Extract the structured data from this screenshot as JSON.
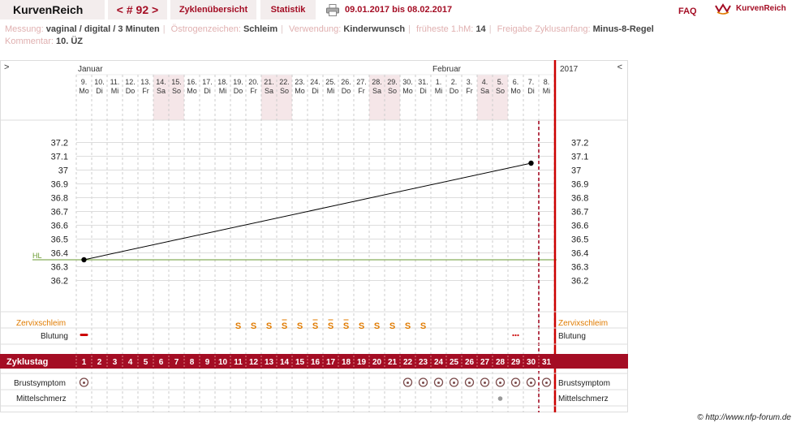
{
  "header": {
    "app_title": "KurvenReich",
    "cycle_nav": "< # 92 >",
    "tab_cycles": "Zyklenübersicht",
    "tab_stats": "Statistik",
    "date_range": "09.01.2017 bis 08.02.2017",
    "faq": "FAQ",
    "logo_text": "KurvenReich"
  },
  "meta": {
    "messung_label": "Messung:",
    "messung_value": "vaginal / digital / 3 Minuten",
    "oestrogen_label": "Östrogenzeichen:",
    "oestrogen_value": "Schleim",
    "verwendung_label": "Verwendung:",
    "verwendung_value": "Kinderwunsch",
    "frueheste_label": "früheste 1.hM:",
    "frueheste_value": "14",
    "freigabe_label": "Freigabe Zyklusanfang:",
    "freigabe_value": "Minus-8-Regel",
    "kommentar_label": "Kommentar:",
    "kommentar_value": "10. ÜZ"
  },
  "chart_data": {
    "type": "line",
    "months": [
      {
        "label": "Januar",
        "start_index": 0
      },
      {
        "label": "Februar",
        "start_index": 23
      }
    ],
    "year_label": "2017",
    "nav_left": ">",
    "nav_right": "<",
    "dates": [
      "9.",
      "10.",
      "11.",
      "12.",
      "13.",
      "14.",
      "15.",
      "16.",
      "17.",
      "18.",
      "19.",
      "20.",
      "21.",
      "22.",
      "23.",
      "24.",
      "25.",
      "26.",
      "27.",
      "28.",
      "29.",
      "30.",
      "31.",
      "1.",
      "2.",
      "3.",
      "4.",
      "5.",
      "6.",
      "7.",
      "8."
    ],
    "weekdays": [
      "Mo",
      "Di",
      "Mi",
      "Do",
      "Fr",
      "Sa",
      "So",
      "Mo",
      "Di",
      "Mi",
      "Do",
      "Fr",
      "Sa",
      "So",
      "Mo",
      "Di",
      "Mi",
      "Do",
      "Fr",
      "Sa",
      "So",
      "Mo",
      "Di",
      "Mi",
      "Do",
      "Fr",
      "Sa",
      "So",
      "Mo",
      "Di",
      "Mi"
    ],
    "weekend_indices": [
      5,
      6,
      12,
      13,
      19,
      20,
      26,
      27
    ],
    "y_ticks": [
      37.2,
      37.1,
      37,
      36.9,
      36.8,
      36.7,
      36.6,
      36.5,
      36.4,
      36.3,
      36.2
    ],
    "y_tick_labels": [
      "37.2",
      "37.1",
      "37",
      "36.9",
      "36.8",
      "36.7",
      "36.6",
      "36.5",
      "36.4",
      "36.3",
      "36.2"
    ],
    "ylim": [
      36.15,
      37.25
    ],
    "temperature_points": [
      {
        "day": 1,
        "value": 36.35
      },
      {
        "day": 30,
        "value": 37.05
      }
    ],
    "hilo_label": "HL",
    "hilo_value": 36.35,
    "today_marker_day": 30.5,
    "zervix_label": "Zervixschleim",
    "zervix": [
      {
        "day": 11,
        "mark": "S"
      },
      {
        "day": 12,
        "mark": "S"
      },
      {
        "day": 13,
        "mark": "S"
      },
      {
        "day": 14,
        "mark": "S+"
      },
      {
        "day": 15,
        "mark": "S"
      },
      {
        "day": 16,
        "mark": "S+"
      },
      {
        "day": 17,
        "mark": "S+"
      },
      {
        "day": 18,
        "mark": "S+"
      },
      {
        "day": 19,
        "mark": "S"
      },
      {
        "day": 20,
        "mark": "S"
      },
      {
        "day": 21,
        "mark": "S"
      },
      {
        "day": 22,
        "mark": "S"
      },
      {
        "day": 23,
        "mark": "S"
      }
    ],
    "blutung_label": "Blutung",
    "blutung": [
      {
        "day": 1,
        "mark": "dash"
      },
      {
        "day": 29,
        "mark": "dots"
      }
    ],
    "zyklustag_label": "Zyklustag",
    "zyklustage": [
      "1",
      "2",
      "3",
      "4",
      "5",
      "6",
      "7",
      "8",
      "9",
      "10",
      "11",
      "12",
      "13",
      "14",
      "15",
      "16",
      "17",
      "18",
      "19",
      "20",
      "21",
      "22",
      "23",
      "24",
      "25",
      "26",
      "27",
      "28",
      "29",
      "30",
      "31"
    ],
    "brust_label": "Brustsymptom",
    "brust_days": [
      1,
      22,
      23,
      24,
      25,
      26,
      27,
      28,
      29,
      30,
      31
    ],
    "mittel_label": "Mittelschmerz",
    "mittel_days": [
      28
    ],
    "colors": {
      "accent": "#a40d24",
      "zervix": "#e07b00",
      "grid": "#dddddd",
      "weekend": "#f5e6e8",
      "hilo": "#6a9a30",
      "line": "#000000"
    }
  },
  "footer": {
    "copyright": "© http://www.nfp-forum.de"
  }
}
